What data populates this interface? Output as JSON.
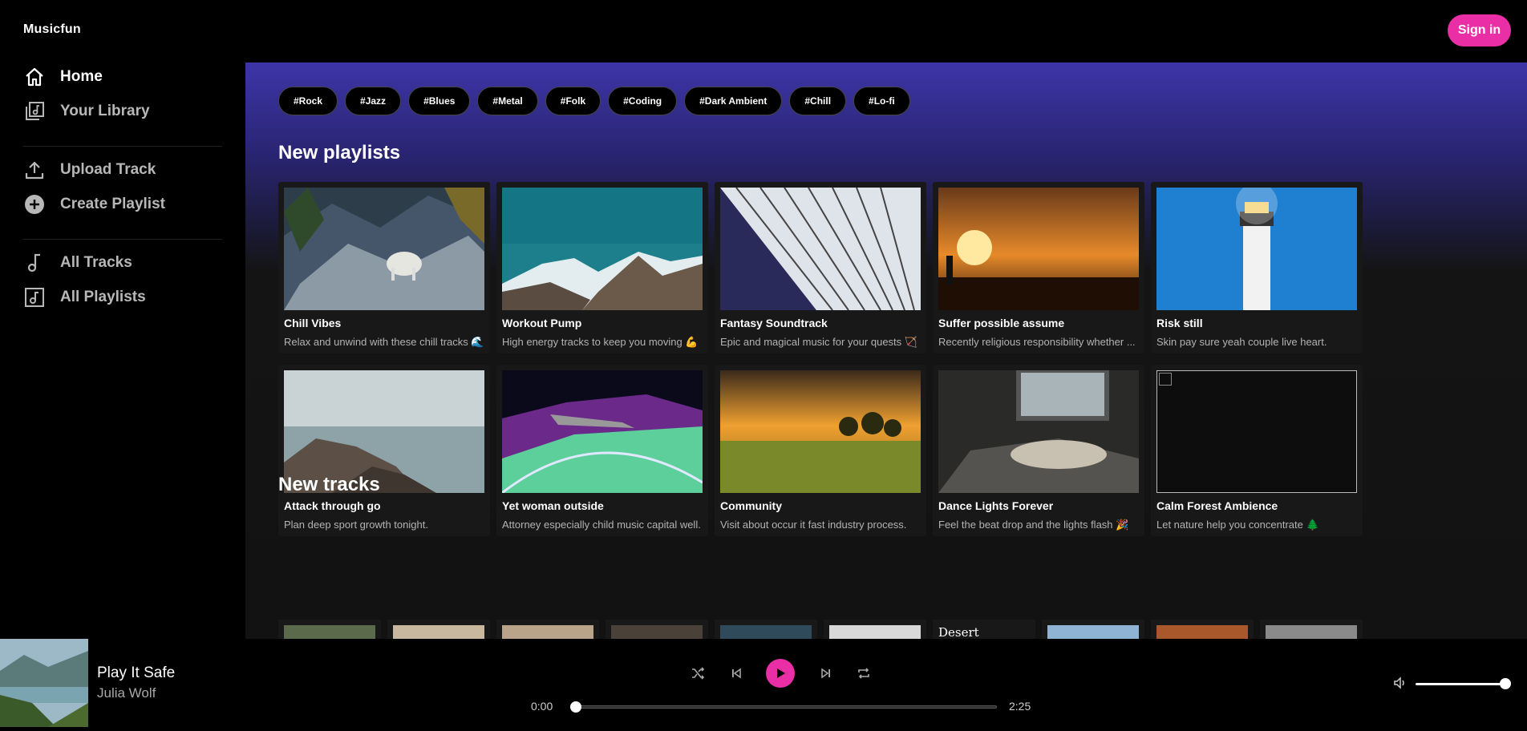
{
  "app": {
    "brand": "Musicfun",
    "sign_in": "Sign in"
  },
  "sidebar": {
    "items": [
      {
        "label": "Home",
        "icon": "home-icon",
        "active": true
      },
      {
        "label": "Your Library",
        "icon": "library-icon"
      },
      {
        "label": "Upload Track",
        "icon": "upload-icon"
      },
      {
        "label": "Create Playlist",
        "icon": "plus-circle-icon"
      },
      {
        "label": "All Tracks",
        "icon": "music-note-icon"
      },
      {
        "label": "All Playlists",
        "icon": "playlist-icon"
      }
    ]
  },
  "tags": [
    "#Rock",
    "#Jazz",
    "#Blues",
    "#Metal",
    "#Folk",
    "#Coding",
    "#Dark Ambient",
    "#Chill",
    "#Lo-fi"
  ],
  "sections": {
    "playlists_title": "New playlists",
    "tracks_title": "New tracks"
  },
  "playlists": [
    {
      "title": "Chill Vibes",
      "desc": "Relax and unwind with these chill tracks 🌊",
      "scene": "goat"
    },
    {
      "title": "Workout Pump",
      "desc": "High energy tracks to keep you moving 💪",
      "scene": "mountain"
    },
    {
      "title": "Fantasy Soundtrack",
      "desc": "Epic and magical music for your quests 🏹",
      "scene": "building"
    },
    {
      "title": "Suffer possible assume",
      "desc": "Recently religious responsibility whether ...",
      "scene": "sunset"
    },
    {
      "title": "Risk still",
      "desc": "Skin pay sure yeah couple live heart.",
      "scene": "lighthouse"
    },
    {
      "title": "Attack through go",
      "desc": "Plan deep sport growth tonight.",
      "scene": "rocks"
    },
    {
      "title": "Yet woman outside",
      "desc": "Attorney especially child music capital well.",
      "scene": "space"
    },
    {
      "title": "Community",
      "desc": "Visit about occur it fast industry process.",
      "scene": "field"
    },
    {
      "title": "Dance Lights Forever",
      "desc": "Feel the beat drop and the lights flash 🎉",
      "scene": "bed"
    },
    {
      "title": "Calm Forest Ambience",
      "desc": "Let nature help you concentrate 🌲",
      "scene": "broken"
    }
  ],
  "tracks": [
    {
      "color": "#5b6a4a"
    },
    {
      "color": "#c8b8a0"
    },
    {
      "color": "#b9a48a"
    },
    {
      "color": "#4a4238"
    },
    {
      "color": "#2f4a5a"
    },
    {
      "color": "#d9d9d9"
    },
    {
      "alt": "Desert"
    },
    {
      "color": "#8fb3d4"
    },
    {
      "color": "#a8582a"
    },
    {
      "color": "#8a8a8a"
    }
  ],
  "player": {
    "title": "Play It Safe",
    "artist": "Julia Wolf",
    "current_time": "0:00",
    "duration": "2:25",
    "progress": 0,
    "volume": 1.0
  }
}
